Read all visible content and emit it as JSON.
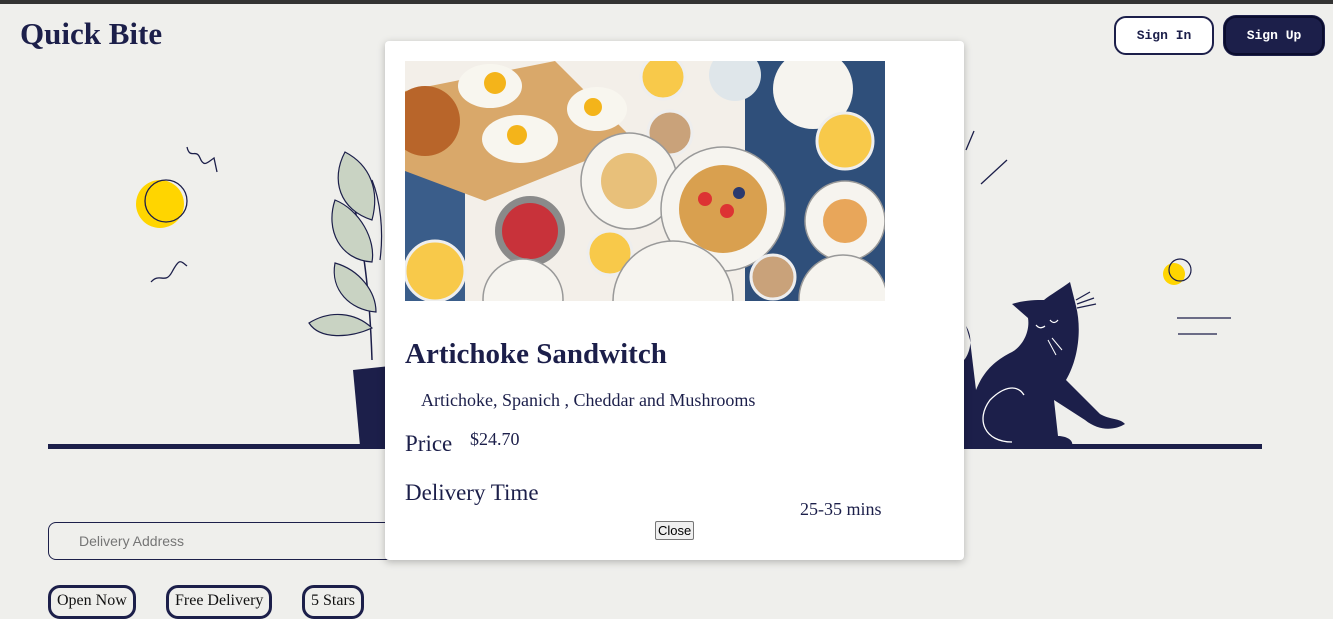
{
  "header": {
    "brand": "Quick Bite",
    "sign_in_label": "Sign In",
    "sign_up_label": "Sign Up"
  },
  "search": {
    "address_placeholder": "Delivery Address",
    "address_value": ""
  },
  "filters": [
    {
      "label": "Open Now"
    },
    {
      "label": "Free Delivery"
    },
    {
      "label": "5 Stars"
    }
  ],
  "modal": {
    "title": "Artichoke Sandwitch",
    "description": "Artichoke, Spanich , Cheddar and Mushrooms",
    "price_label": "Price",
    "price_value": "$24.70",
    "delivery_label": "Delivery Time",
    "delivery_value": "25-35 mins",
    "close_label": "Close"
  },
  "colors": {
    "navy": "#1c1f4a",
    "background": "#efefec",
    "sun_yellow": "#ffd500",
    "leaf_green": "#c9d3c3"
  }
}
